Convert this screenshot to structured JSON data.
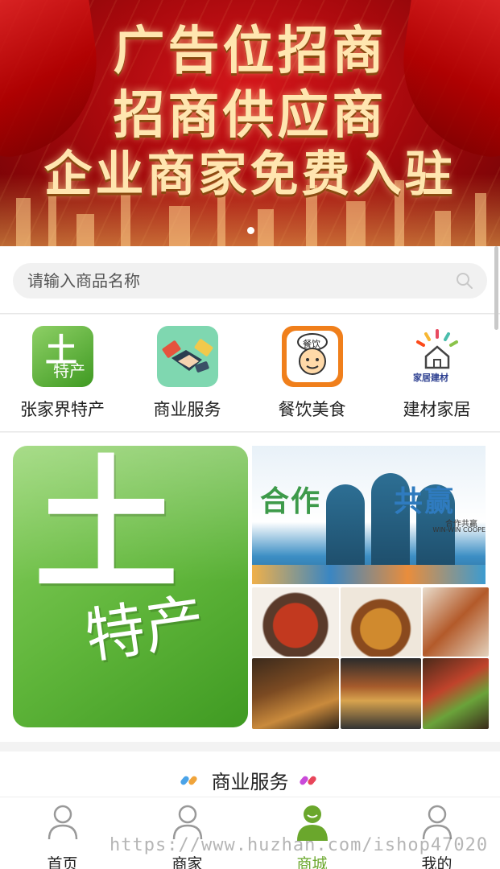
{
  "banner": {
    "line1": "广告位招商",
    "line2": "招商供应商",
    "line3": "企业商家免费入驻",
    "active_dot": 1,
    "dot_count": 1
  },
  "search": {
    "placeholder": "请输入商品名称",
    "value": ""
  },
  "categories": [
    {
      "label": "张家界特产",
      "icon": "local-specialty-icon",
      "icon_text_top": "土",
      "icon_text_bottom": "特产"
    },
    {
      "label": "商业服务",
      "icon": "handshake-icon"
    },
    {
      "label": "餐饮美食",
      "icon": "chef-icon",
      "icon_text": "餐饮"
    },
    {
      "label": "建材家居",
      "icon": "home-building-icon",
      "icon_text": "家居建材"
    }
  ],
  "promo": {
    "left": {
      "top_char": "土",
      "bottom_chars": "特产"
    },
    "right_top": {
      "title_part1": "合作",
      "title_part2": "共赢",
      "sub1": "合作共赢",
      "sub2": "WIN-WIN COOPE"
    },
    "right_bottom": {
      "alt": "food-collage"
    }
  },
  "section": {
    "title": "商业服务",
    "deco_left_colors": [
      "#4aa3e8",
      "#f0a43a"
    ],
    "deco_right_colors": [
      "#c94ad9",
      "#e8455a"
    ]
  },
  "nav": {
    "items": [
      {
        "label": "首页",
        "icon": "user-outline-icon",
        "active": false
      },
      {
        "label": "商家",
        "icon": "user-outline-icon",
        "active": false
      },
      {
        "label": "商城",
        "icon": "user-filled-icon",
        "active": true
      },
      {
        "label": "我的",
        "icon": "user-outline-icon",
        "active": false
      }
    ],
    "active_color": "#6aa72c"
  },
  "watermark": "https://www.huzhan.com/ishop47020"
}
